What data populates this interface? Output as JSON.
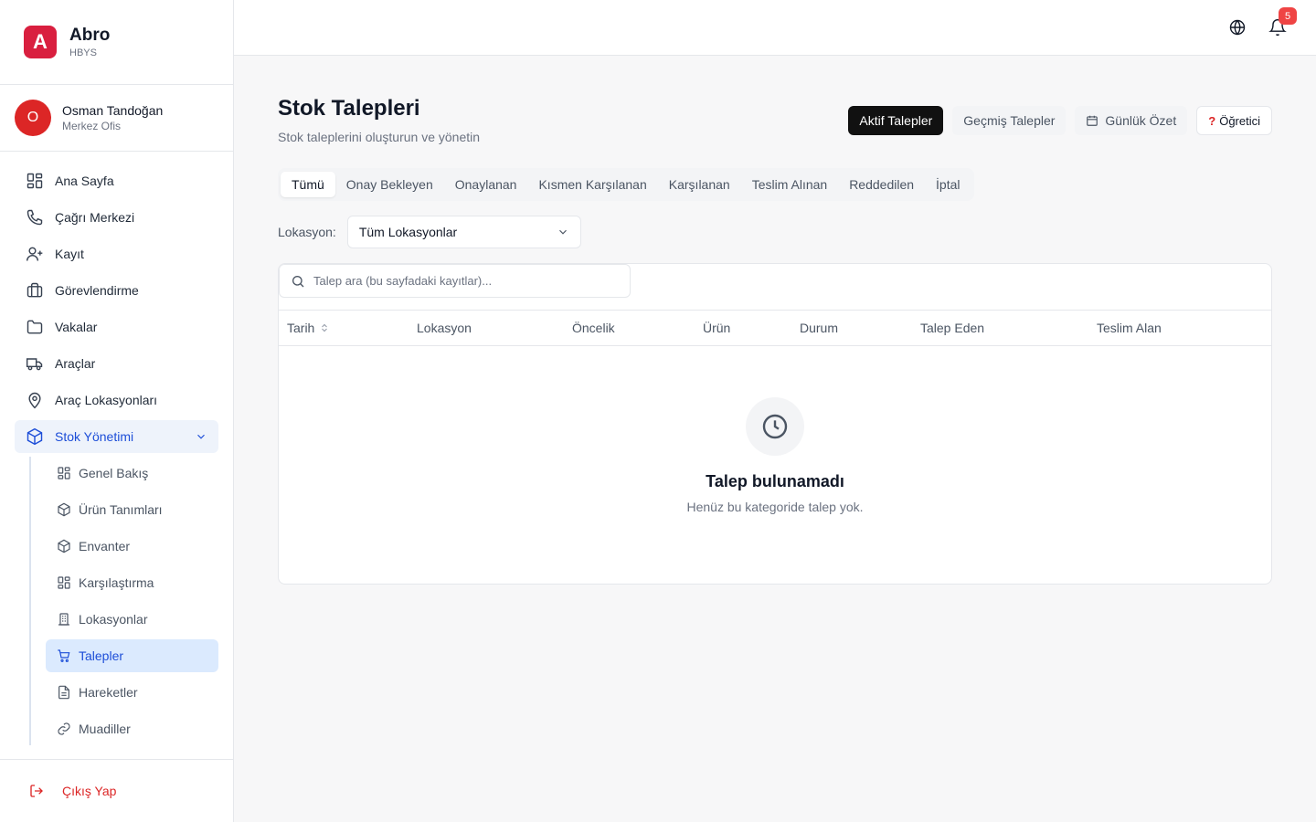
{
  "brand": {
    "logo_letter": "A",
    "name": "Abro",
    "subtitle": "HBYS",
    "color": "#d91f3f"
  },
  "user": {
    "initial": "O",
    "name": "Osman Tandoğan",
    "role": "Merkez Ofis"
  },
  "sidebar": {
    "items": [
      {
        "label": "Ana Sayfa",
        "icon": "grid-icon"
      },
      {
        "label": "Çağrı Merkezi",
        "icon": "phone-icon"
      },
      {
        "label": "Kayıt",
        "icon": "user-plus-icon"
      },
      {
        "label": "Görevlendirme",
        "icon": "briefcase-icon"
      },
      {
        "label": "Vakalar",
        "icon": "folder-icon"
      },
      {
        "label": "Araçlar",
        "icon": "truck-icon"
      },
      {
        "label": "Araç Lokasyonları",
        "icon": "map-pin-icon"
      },
      {
        "label": "Stok Yönetimi",
        "icon": "package-icon",
        "expanded": true
      }
    ],
    "stock_sub": [
      {
        "label": "Genel Bakış",
        "icon": "grid-icon"
      },
      {
        "label": "Ürün Tanımları",
        "icon": "package-icon"
      },
      {
        "label": "Envanter",
        "icon": "package-icon"
      },
      {
        "label": "Karşılaştırma",
        "icon": "grid-icon"
      },
      {
        "label": "Lokasyonlar",
        "icon": "building-icon"
      },
      {
        "label": "Talepler",
        "icon": "cart-icon",
        "active": true
      },
      {
        "label": "Hareketler",
        "icon": "file-icon"
      },
      {
        "label": "Muadiller",
        "icon": "link-icon"
      }
    ],
    "logout": "Çıkış Yap"
  },
  "topbar": {
    "notification_count": "5"
  },
  "page": {
    "title": "Stok Talepleri",
    "subtitle": "Stok taleplerini oluşturun ve yönetin",
    "actions": {
      "active": "Aktif Talepler",
      "past": "Geçmiş Talepler",
      "daily": "Günlük Özet",
      "tutorial_mark": "?",
      "tutorial": "Öğretici"
    },
    "tabs": [
      "Tümü",
      "Onay Bekleyen",
      "Onaylanan",
      "Kısmen Karşılanan",
      "Karşılanan",
      "Teslim Alınan",
      "Reddedilen",
      "İptal"
    ],
    "location_label": "Lokasyon:",
    "location_value": "Tüm Lokasyonlar",
    "search_placeholder": "Talep ara (bu sayfadaki kayıtlar)...",
    "columns": [
      "Tarih",
      "Lokasyon",
      "Öncelik",
      "Ürün",
      "Durum",
      "Talep Eden",
      "Teslim Alan"
    ],
    "empty": {
      "title": "Talep bulunamadı",
      "subtitle": "Henüz bu kategoride talep yok."
    }
  }
}
